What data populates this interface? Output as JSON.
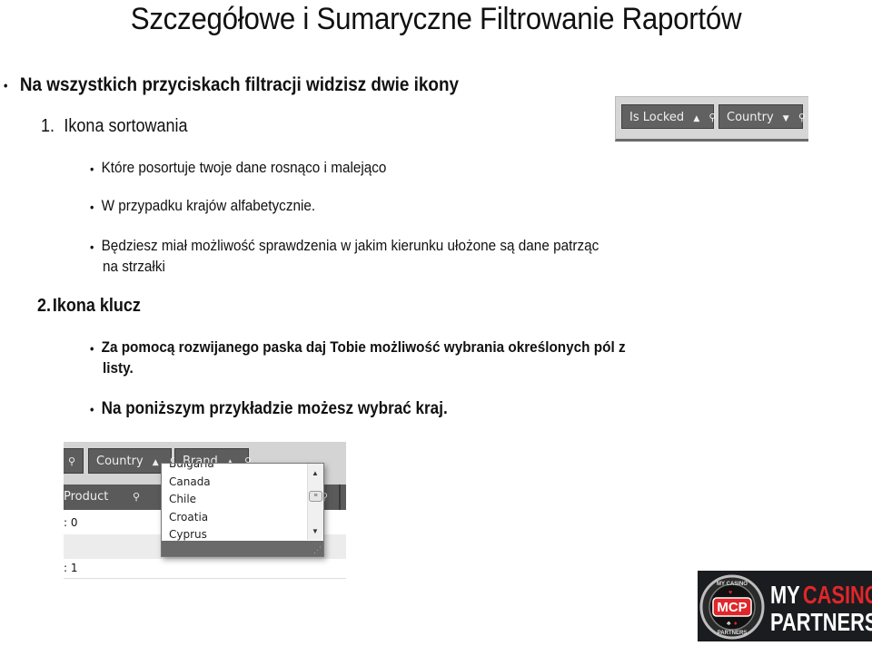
{
  "title": "Szczegółowe i Sumaryczne Filtrowanie Raportów",
  "intro": {
    "bullet": "•",
    "text": "Na wszystkich przyciskach filtracji widzisz dwie ikony"
  },
  "section1": {
    "number": "1.",
    "heading": "Ikona sortowania",
    "points": [
      "Które posortuje twoje dane rosnąco i malejąco",
      "W przypadku krajów alfabetycznie.",
      "Będziesz miał możliwość sprawdzenia w jakim kierunku ułożone są dane patrząc",
      "na strzałki"
    ]
  },
  "section2": {
    "number": "2.",
    "heading": "Ikona klucz",
    "points": [
      "Za pomocą rozwijanego paska daj Tobie możliwość wybrania określonych pól z",
      "listy.",
      "Na poniższym przykładzie możesz wybrać kraj."
    ]
  },
  "screenshot_sort": {
    "buttons": [
      {
        "label": "Is Locked",
        "sort_icon": "▲",
        "filter_icon": "🝖"
      },
      {
        "label": "Country",
        "sort_icon": "▼",
        "filter_icon": "🝖"
      }
    ]
  },
  "screenshot_filter": {
    "buttons": [
      {
        "label": "Country",
        "sort_icon": "▲"
      },
      {
        "label": "Brand",
        "sort_icon": "▲"
      }
    ],
    "column_header": "Product",
    "rows": [
      ": 0",
      ": 1"
    ],
    "dropdown_items": [
      "Bulgaria",
      "Canada",
      "Chile",
      "Croatia",
      "Cyprus"
    ]
  },
  "logo": {
    "badge_text": "MCP",
    "ring_top": "MY CASINO",
    "ring_bottom": "PARTNERS",
    "line1_a": "MY",
    "line1_b": "CASINO",
    "line2": "PARTNERS",
    "accent_color": "#e0262a"
  }
}
